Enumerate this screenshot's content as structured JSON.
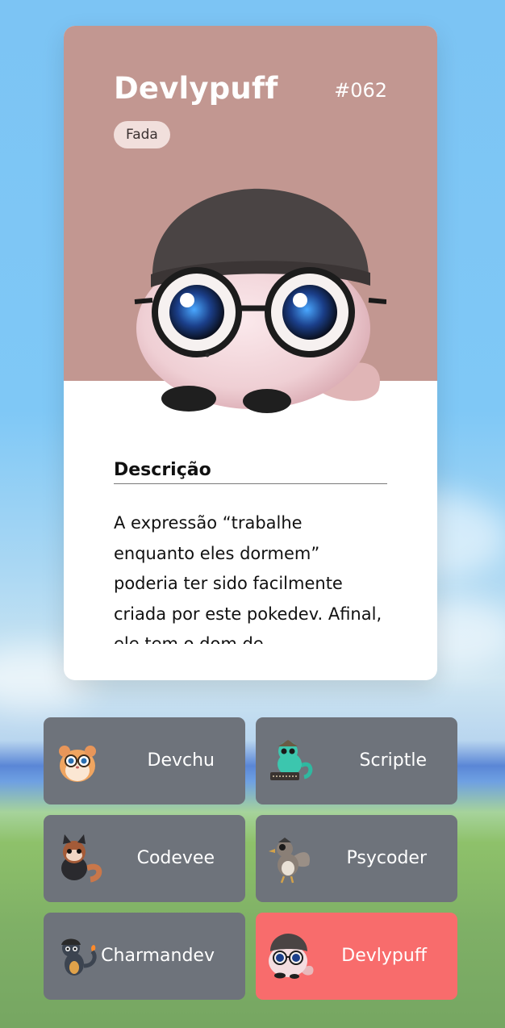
{
  "pokemon": {
    "name": "Devlypuff",
    "number": "#062",
    "type": "Fada",
    "card_color": "#c29791",
    "image_icon": "devlypuff-creature-icon"
  },
  "description": {
    "title": "Descrição",
    "text": "A expressão “trabalhe enquanto eles dormem” poderia ter sido facilmente criada por este pokedev. Afinal, ele tem o dom de"
  },
  "selector": {
    "items": [
      {
        "label": "Devchu",
        "icon": "devchu-hamster-icon",
        "active": false
      },
      {
        "label": "Scriptle",
        "icon": "scriptle-dragon-icon",
        "active": false
      },
      {
        "label": "Codevee",
        "icon": "codevee-fox-icon",
        "active": false
      },
      {
        "label": "Psycoder",
        "icon": "psycoder-duck-icon",
        "active": false
      },
      {
        "label": "Charmandev",
        "icon": "charmandev-lizard-icon",
        "active": false
      },
      {
        "label": "Devlypuff",
        "icon": "devlypuff-puff-icon",
        "active": true
      }
    ],
    "button_color": "#6e737b",
    "active_color": "#f86c6c"
  }
}
